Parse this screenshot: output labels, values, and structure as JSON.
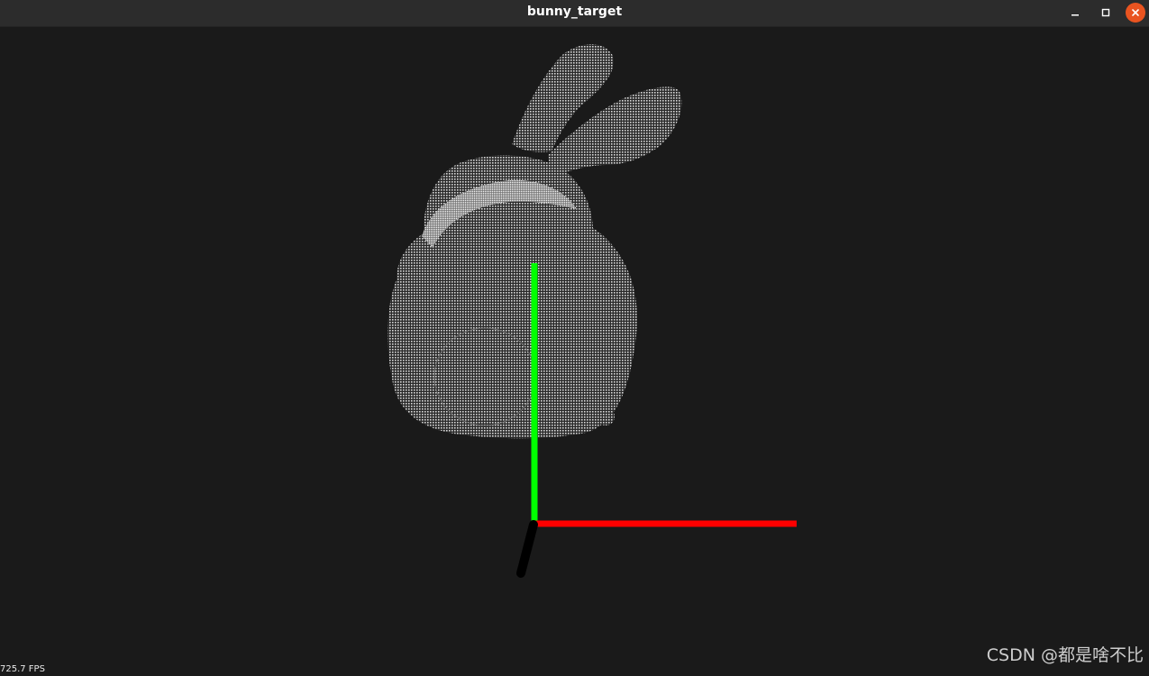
{
  "window": {
    "title": "bunny_target"
  },
  "controls": {
    "minimize_icon": "minimize-icon",
    "maximize_icon": "maximize-icon",
    "close_icon": "close-icon",
    "close_color": "#e95420"
  },
  "viewport": {
    "background_color": "#1a1a1a",
    "point_cloud_color": "#d8d8d8",
    "axes": {
      "x_color": "#ff0000",
      "y_color": "#00ff00",
      "z_color": "#000000"
    },
    "fps_text": "725.7 FPS"
  },
  "watermark": {
    "text": "CSDN @都是啥不比"
  }
}
